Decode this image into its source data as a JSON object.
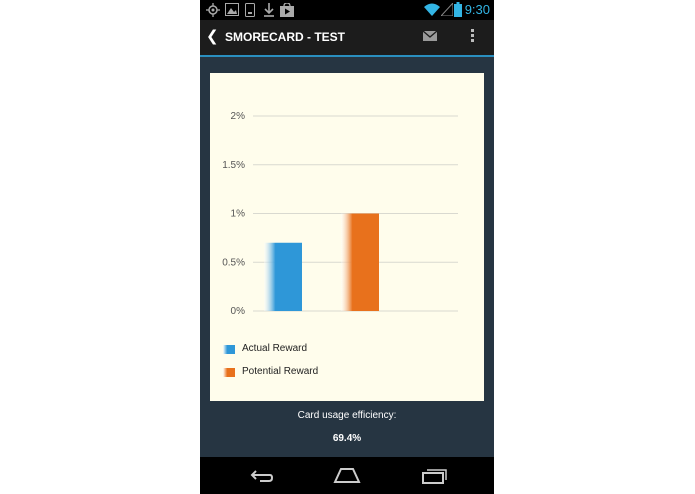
{
  "status_bar": {
    "time": "9:30",
    "icons": [
      "gps-icon",
      "image-icon",
      "phone-icon",
      "download-icon",
      "play-store-icon",
      "wifi-icon",
      "signal-icon",
      "battery-icon"
    ]
  },
  "action_bar": {
    "title": "SMORECARD - TEST",
    "back_icon": "chevron-left-icon",
    "mail_icon": "mail-icon",
    "overflow_icon": "overflow-menu-icon"
  },
  "chart_data": {
    "type": "bar",
    "categories": [
      "Actual Reward",
      "Potential Reward"
    ],
    "values": [
      0.7,
      1.0
    ],
    "unit": "%",
    "ylim": [
      0,
      2
    ],
    "yticks": [
      "0%",
      "0.5%",
      "1%",
      "1.5%",
      "2%"
    ],
    "ytick_values": [
      0,
      0.5,
      1,
      1.5,
      2
    ],
    "colors": [
      "#2e97d8",
      "#e8711c"
    ],
    "legend": [
      "Actual Reward",
      "Potential Reward"
    ],
    "legend_position": "bottom-left",
    "grid": true
  },
  "summary": {
    "efficiency_label": "Card usage efficiency:",
    "efficiency_value": "69.4%"
  },
  "nav_bar": {
    "back": "back-icon",
    "home": "home-icon",
    "recents": "recent-apps-icon"
  }
}
